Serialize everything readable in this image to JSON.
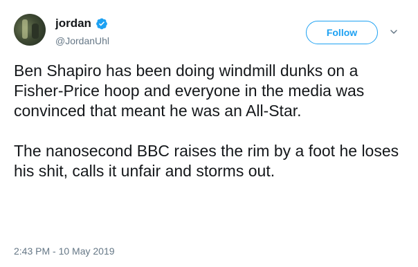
{
  "tweet": {
    "display_name": "jordan",
    "handle": "@JordanUhl",
    "follow_label": "Follow",
    "paragraphs": [
      "Ben Shapiro has been doing windmill dunks on a Fisher-Price hoop and everyone in the media was convinced that meant he was an All-Star.",
      "The nanosecond BBC raises the rim by a foot he loses his shit, calls it unfair and storms out."
    ],
    "timestamp": "2:43 PM - 10 May 2019"
  },
  "icons": {
    "verified": "verified-badge-icon",
    "menu": "chevron-down-icon"
  },
  "colors": {
    "accent": "#1da1f2",
    "text": "#14171a",
    "secondary_text": "#657786"
  }
}
